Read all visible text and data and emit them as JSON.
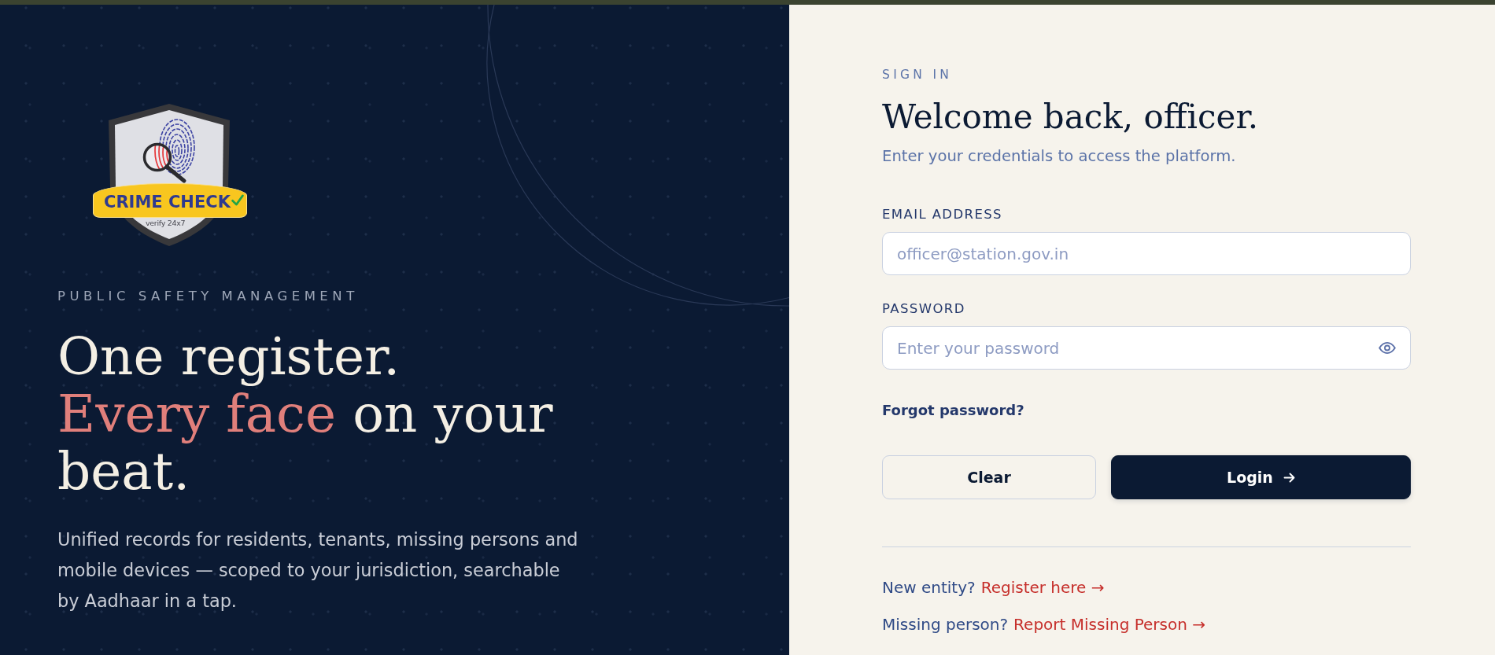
{
  "hero": {
    "logo": {
      "name": "CRIME CHECK",
      "tagline": "verify 24x7"
    },
    "eyebrow": "PUBLIC SAFETY MANAGEMENT",
    "headline": [
      [
        {
          "text": "One register.",
          "highlighted": false
        }
      ],
      [
        {
          "text": "Every face",
          "highlighted": true
        },
        {
          "text": "on your beat.",
          "highlighted": false
        }
      ]
    ],
    "description": "Unified records for residents, tenants, missing persons and mobile devices — scoped to your jurisdiction, searchable by Aadhaar in a tap."
  },
  "sign_in": {
    "eyebrow": "SIGN IN",
    "title": "Welcome back, officer.",
    "subtitle": "Enter your credentials to access the platform.",
    "fields": [
      {
        "kind": "email",
        "label": "EMAIL ADDRESS",
        "placeholder": "officer@station.gov.in"
      },
      {
        "kind": "password",
        "label": "PASSWORD",
        "placeholder": "Enter your password"
      }
    ],
    "forgot_password": "Forgot password?",
    "buttons": [
      {
        "kind": "secondary",
        "label": "Clear"
      },
      {
        "kind": "primary",
        "label": "Login"
      }
    ],
    "links": [
      {
        "prompt": "New entity?",
        "link": "Register here →"
      },
      {
        "prompt": "Missing person?",
        "link": "Report Missing Person →"
      }
    ]
  }
}
